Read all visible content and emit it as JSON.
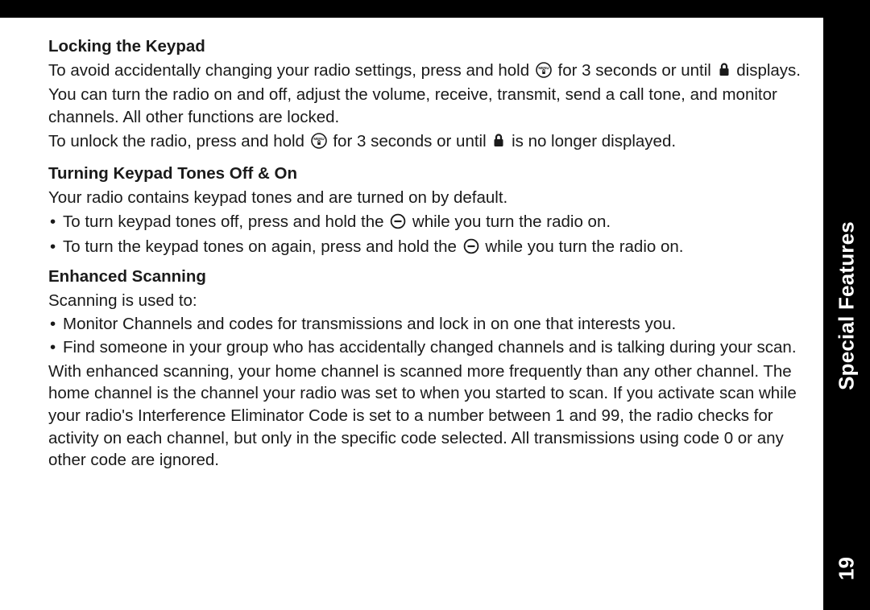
{
  "sidebar": {
    "label": "Special Features",
    "page_number": "19"
  },
  "icons": {
    "menu_lock": "menu-lock-icon",
    "lock": "lock-icon",
    "circle_minus": "circle-minus-icon"
  },
  "sections": {
    "locking": {
      "title": "Locking the Keypad",
      "p1a": "To avoid accidentally changing your radio settings, press and hold ",
      "p1b": " for 3 seconds or until ",
      "p1c": " displays. You can turn the radio on and off, adjust the volume, receive, transmit, send a call tone, and monitor channels. All other functions are locked.",
      "p2a": "To unlock the radio, press and hold ",
      "p2b": " for 3 seconds or until ",
      "p2c": " is no longer displayed."
    },
    "tones": {
      "title": "Turning Keypad Tones Off & On",
      "intro": "Your radio contains keypad tones and are turned on by default.",
      "b1a": "To turn keypad tones off, press and hold the ",
      "b1b": " while you turn the radio on.",
      "b2a": "To turn the keypad tones on again, press and hold the ",
      "b2b": " while you turn the radio on."
    },
    "scanning": {
      "title": "Enhanced Scanning",
      "intro": "Scanning is used to:",
      "b1": "Monitor Channels and codes for transmissions and lock in on one that interests you.",
      "b2": "Find someone in your group who has accidentally changed channels and is talking during your scan.",
      "para": "With enhanced scanning, your home channel is scanned more frequently than any other channel. The home channel is the channel your radio was set to when you started to scan. If you activate scan while your radio's Interference Eliminator Code is set to a number between 1 and 99, the radio checks for activity on each channel, but only in the specific code selected. All transmissions using code 0 or any other code are ignored."
    }
  }
}
